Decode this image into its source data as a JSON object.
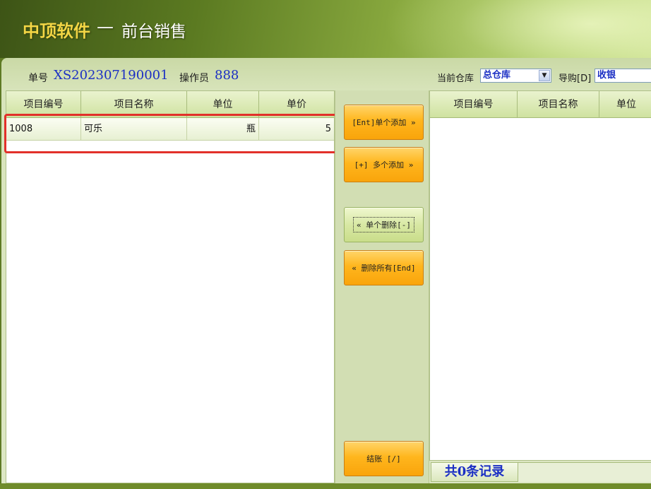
{
  "header": {
    "app_name": "中顶软件",
    "separator": "—",
    "module_name": "前台销售"
  },
  "info_bar": {
    "order_label": "单号",
    "order_no": "XS202307190001",
    "operator_label": "操作员",
    "operator": "888",
    "warehouse_label": "当前仓库",
    "warehouse_value": "总仓库",
    "guide_label": "导购[D]",
    "guide_value": "收银"
  },
  "left_grid": {
    "columns": [
      "项目编号",
      "项目名称",
      "单位",
      "单价"
    ],
    "rows": [
      {
        "code": "1008",
        "name": "可乐",
        "unit": "瓶",
        "price": "5"
      }
    ]
  },
  "right_grid": {
    "columns": [
      "项目编号",
      "项目名称",
      "单位"
    ]
  },
  "buttons": {
    "add_single": "[Ent]单个添加 »",
    "add_multi": "[+] 多个添加 »",
    "delete_single": "«  单个删除[-]",
    "delete_all": "«  删除所有[End]",
    "checkout": "结账 [/]"
  },
  "status": {
    "record_count": "共0条记录"
  },
  "colors": {
    "accent_blue": "#1b2fc4",
    "button_orange": "#ffb61d",
    "highlight_red": "#e2302a",
    "title_gold": "#f3d645"
  }
}
